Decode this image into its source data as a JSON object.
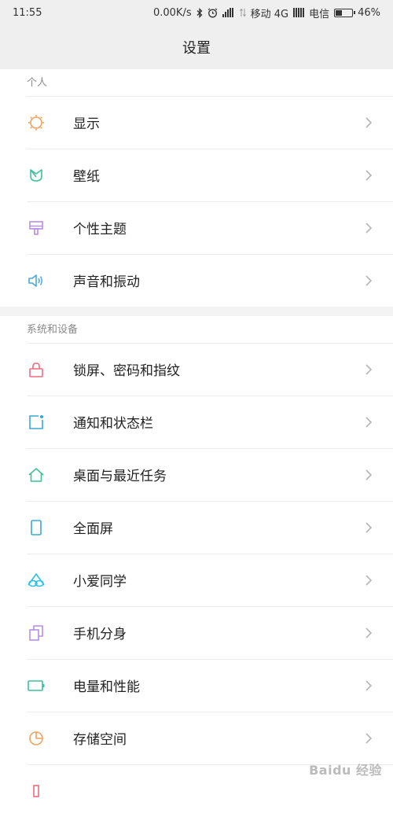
{
  "status_bar": {
    "time": "11:55",
    "speed": "0.00K/s",
    "carrier1": "移动 4G",
    "carrier2": "电信",
    "battery": "46%",
    "battery_level": 0.46
  },
  "header": {
    "title": "设置"
  },
  "sections": [
    {
      "title": "个人",
      "items": [
        {
          "label": "显示",
          "icon": "sun-icon",
          "color": "#f0a15a"
        },
        {
          "label": "壁纸",
          "icon": "tulip-icon",
          "color": "#3fbfa0"
        },
        {
          "label": "个性主题",
          "icon": "brush-icon",
          "color": "#b58ee8"
        },
        {
          "label": "声音和振动",
          "icon": "speaker-icon",
          "color": "#4aa8e0"
        }
      ]
    },
    {
      "title": "系统和设备",
      "items": [
        {
          "label": "锁屏、密码和指纹",
          "icon": "lock-icon",
          "color": "#ef6b7e"
        },
        {
          "label": "通知和状态栏",
          "icon": "notification-icon",
          "color": "#3aa9d6"
        },
        {
          "label": "桌面与最近任务",
          "icon": "home-icon",
          "color": "#3fbf9a"
        },
        {
          "label": "全面屏",
          "icon": "phone-icon",
          "color": "#3aa9d6"
        },
        {
          "label": "小爱同学",
          "icon": "assistant-icon",
          "color": "#2cc0e8"
        },
        {
          "label": "手机分身",
          "icon": "dual-app-icon",
          "color": "#b58ee8"
        },
        {
          "label": "电量和性能",
          "icon": "battery-icon",
          "color": "#3fbfa0"
        },
        {
          "label": "存储空间",
          "icon": "pie-chart-icon",
          "color": "#f0a15a"
        }
      ]
    }
  ],
  "watermark": "Baidu 经验"
}
